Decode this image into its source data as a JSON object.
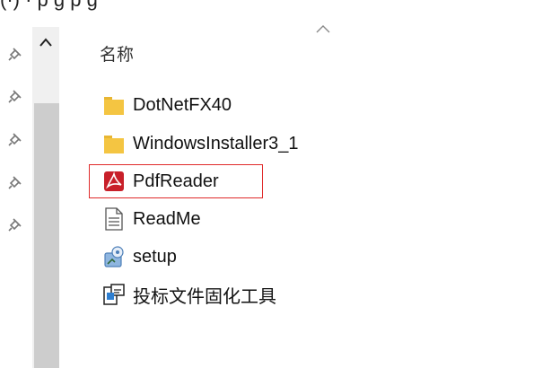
{
  "top_partial_text": "(·)  ·  p     g     p     g",
  "column": {
    "name_header": "名称",
    "sort_icon": "chevron-up-icon"
  },
  "pins": [
    "pin-icon",
    "pin-icon",
    "pin-icon",
    "pin-icon",
    "pin-icon"
  ],
  "files": [
    {
      "name": "DotNetFX40",
      "icon": "folder-icon",
      "selected": false
    },
    {
      "name": "WindowsInstaller3_1",
      "icon": "folder-icon",
      "selected": false
    },
    {
      "name": "PdfReader",
      "icon": "pdf-app-icon",
      "selected": true
    },
    {
      "name": "ReadMe",
      "icon": "text-document-icon",
      "selected": false
    },
    {
      "name": "setup",
      "icon": "setup-icon",
      "selected": false
    },
    {
      "name": "投标文件固化工具",
      "icon": "installer-app-icon",
      "selected": false
    }
  ],
  "colors": {
    "selection_outline": "#e02a2a",
    "folder": "#f4c542",
    "pdf": "#c8202a"
  }
}
